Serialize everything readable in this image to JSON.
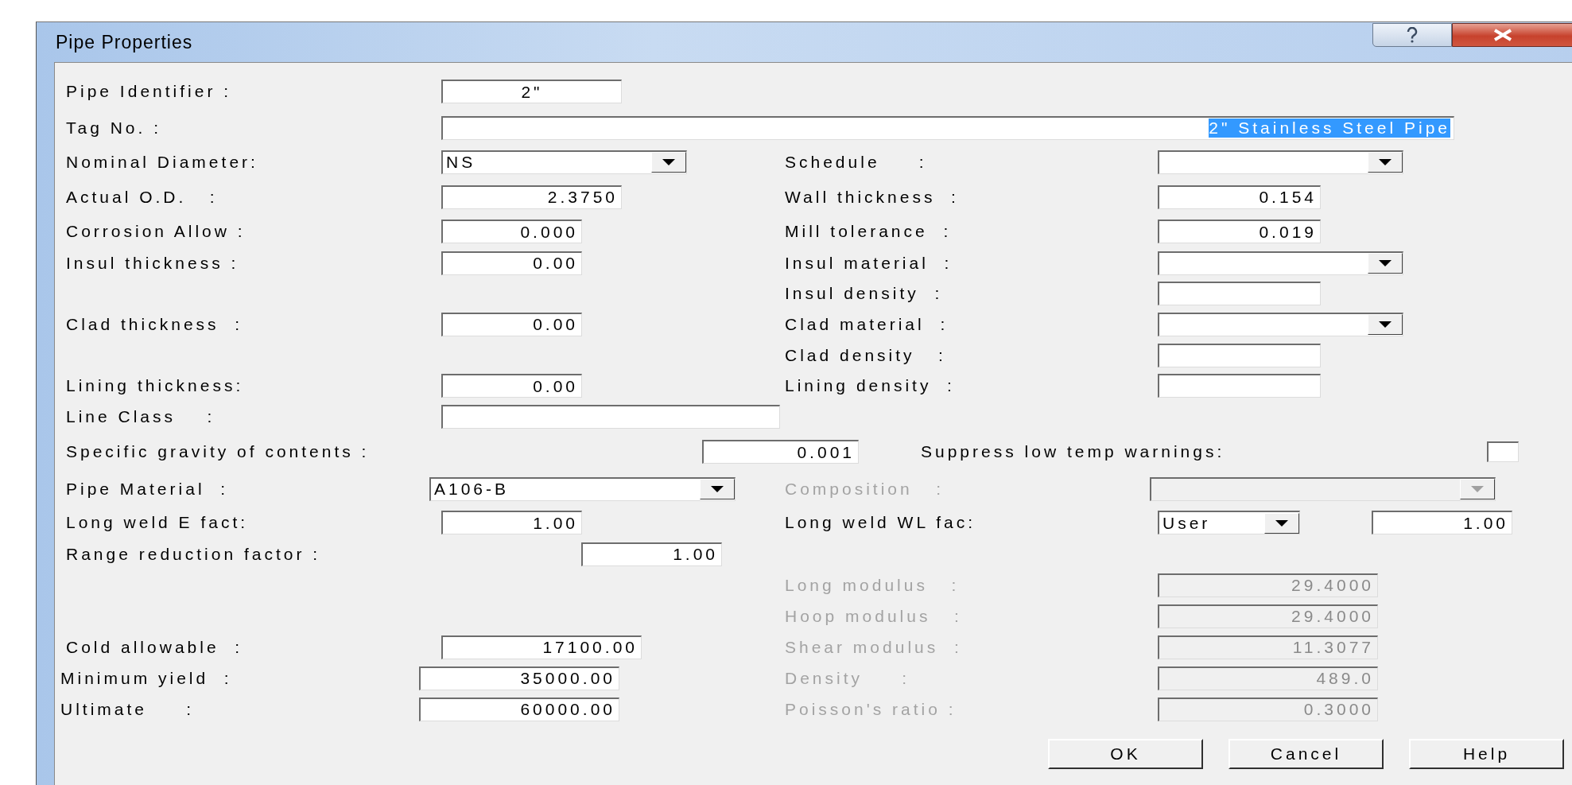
{
  "window": {
    "title": "Pipe Properties"
  },
  "rows": [
    {
      "left": {
        "label": "Pipe Identifier :",
        "disabled": false,
        "controls": [
          {
            "kind": "text",
            "value": "2\""
          }
        ]
      }
    },
    {
      "left": {
        "label": "Tag No. :",
        "disabled": false,
        "controls": [
          {
            "kind": "text",
            "value": "2\" Stainless Steel Pipe",
            "highlighted": true
          }
        ]
      }
    },
    {
      "left": {
        "label": "Nominal Diameter:",
        "disabled": false,
        "controls": [
          {
            "kind": "select",
            "value": "NS"
          }
        ]
      },
      "right": {
        "label": "Schedule     :",
        "disabled": false,
        "controls": [
          {
            "kind": "select"
          }
        ]
      }
    },
    {
      "left": {
        "label": "Actual O.D.   :",
        "disabled": false,
        "controls": [
          {
            "kind": "text",
            "value": "2.3750"
          }
        ]
      },
      "right": {
        "label": "Wall thickness  :",
        "disabled": false,
        "controls": [
          {
            "kind": "text",
            "value": "0.154"
          }
        ]
      }
    },
    {
      "left": {
        "label": "Corrosion Allow :",
        "disabled": false,
        "controls": [
          {
            "kind": "text",
            "value": "0.000"
          }
        ]
      },
      "right": {
        "label": "Mill tolerance  :",
        "disabled": false,
        "controls": [
          {
            "kind": "text",
            "value": "0.019"
          }
        ]
      }
    },
    {
      "left": {
        "label": "Insul thickness :",
        "disabled": false,
        "controls": [
          {
            "kind": "text",
            "value": "0.00"
          }
        ]
      },
      "right": {
        "label": "Insul material  :",
        "disabled": false,
        "controls": [
          {
            "kind": "select"
          }
        ]
      }
    },
    {
      "right": {
        "label": "Insul density  :",
        "disabled": false,
        "controls": [
          {
            "kind": "text"
          }
        ]
      }
    },
    {
      "left": {
        "label": "Clad thickness  :",
        "disabled": false,
        "controls": [
          {
            "kind": "text",
            "value": "0.00"
          }
        ]
      },
      "right": {
        "label": "Clad material  :",
        "disabled": false,
        "controls": [
          {
            "kind": "select"
          }
        ]
      }
    },
    {
      "right": {
        "label": "Clad density   :",
        "disabled": false,
        "controls": [
          {
            "kind": "text"
          }
        ]
      }
    },
    {
      "left": {
        "label": "Lining thickness:",
        "disabled": false,
        "controls": [
          {
            "kind": "text",
            "value": "0.00"
          }
        ]
      },
      "right": {
        "label": "Lining density  :",
        "disabled": false,
        "controls": [
          {
            "kind": "text"
          }
        ]
      }
    },
    {
      "left": {
        "label": "Line Class    :",
        "disabled": false,
        "controls": [
          {
            "kind": "text"
          }
        ]
      }
    },
    {
      "left": {
        "label": "Specific gravity of contents :",
        "disabled": false,
        "controls": [
          {
            "kind": "text",
            "value": "0.001"
          }
        ]
      },
      "right": {
        "label": "Suppress low temp warnings:",
        "disabled": false,
        "controls": [
          {
            "kind": "checkbox",
            "checked": false
          }
        ]
      }
    },
    {
      "left": {
        "label": "Pipe Material  :",
        "disabled": false,
        "controls": [
          {
            "kind": "select",
            "value": "A106-B"
          }
        ]
      },
      "right": {
        "label": "Composition   :",
        "disabled": true,
        "controls": [
          {
            "kind": "select"
          }
        ]
      }
    },
    {
      "left": {
        "label": "Long weld E fact:",
        "disabled": false,
        "controls": [
          {
            "kind": "text",
            "value": "1.00"
          }
        ]
      },
      "right": {
        "label": "Long weld WL fac:",
        "disabled": false,
        "controls": [
          {
            "kind": "select",
            "value": "User"
          },
          {
            "kind": "text",
            "value": "1.00"
          }
        ]
      }
    },
    {
      "left": {
        "label": "Range reduction factor :",
        "disabled": false,
        "controls": [
          {
            "kind": "text",
            "value": "1.00"
          }
        ]
      }
    },
    {
      "right": {
        "label": "Long modulus   :",
        "disabled": true,
        "controls": [
          {
            "kind": "text",
            "value": "29.4000"
          }
        ]
      }
    },
    {
      "right": {
        "label": "Hoop modulus   :",
        "disabled": true,
        "controls": [
          {
            "kind": "text",
            "value": "29.4000"
          }
        ]
      }
    },
    {
      "left": {
        "label": "Cold allowable  :",
        "disabled": false,
        "controls": [
          {
            "kind": "text",
            "value": "17100.00"
          }
        ]
      },
      "right": {
        "label": "Shear modulus  :",
        "disabled": true,
        "controls": [
          {
            "kind": "text",
            "value": "11.3077"
          }
        ]
      }
    },
    {
      "left": {
        "label": "Minimum yield  :",
        "disabled": false,
        "controls": [
          {
            "kind": "text",
            "value": "35000.00"
          }
        ]
      },
      "right": {
        "label": "Density     :",
        "disabled": true,
        "controls": [
          {
            "kind": "text",
            "value": "489.0"
          }
        ]
      }
    },
    {
      "left": {
        "label": "Ultimate     :",
        "disabled": false,
        "controls": [
          {
            "kind": "text",
            "value": "60000.00"
          }
        ]
      },
      "right": {
        "label": "Poisson's ratio :",
        "disabled": true,
        "controls": [
          {
            "kind": "text",
            "value": "0.3000"
          }
        ]
      }
    }
  ],
  "buttons": [
    "OK",
    "Cancel",
    "Help"
  ]
}
